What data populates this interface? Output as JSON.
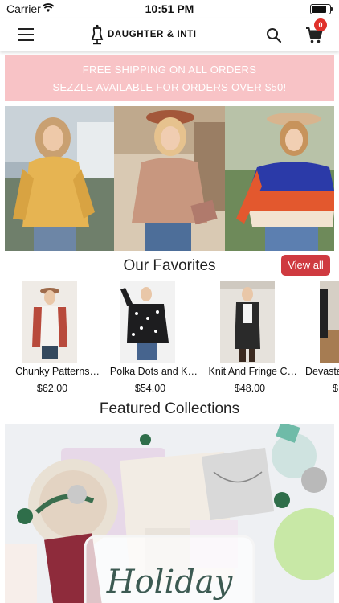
{
  "status_bar": {
    "carrier": "Carrier",
    "time": "10:51 PM",
    "battery_level": 0.92
  },
  "header": {
    "brand": "DAUGHTER & INTI",
    "menu_icon": "hamburger-menu-icon",
    "search_icon": "search-icon",
    "cart_icon": "shopping-cart-icon",
    "cart_count": "0"
  },
  "promo": {
    "line1": "FREE SHIPPING ON ALL ORDERS",
    "line2": "SEZZLE AVAILABLE FOR ORDERS OVER $50!",
    "background": "#f8c3c6"
  },
  "favorites": {
    "title": "Our Favorites",
    "view_all": "View all",
    "products": [
      {
        "name": "Chunky Patterns…",
        "price": "$62.00"
      },
      {
        "name": "Polka Dots and K…",
        "price": "$54.00"
      },
      {
        "name": "Knit And Fringe C…",
        "price": "$48.00"
      },
      {
        "name": "Devasta",
        "price": "$"
      }
    ]
  },
  "featured": {
    "title": "Featured Collections",
    "collection_text": "Holiday"
  },
  "colors": {
    "accent": "#cf3a40",
    "badge": "#e0312b"
  }
}
